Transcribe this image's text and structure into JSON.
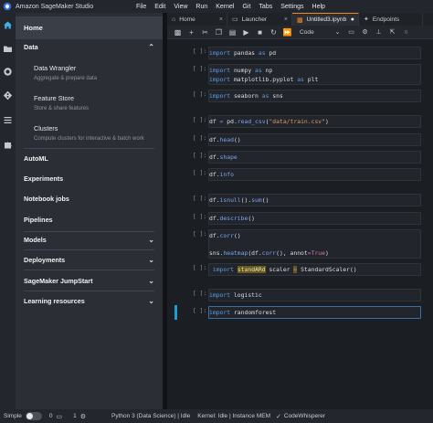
{
  "titlebar": {
    "app_title": "Amazon SageMaker Studio",
    "menu": [
      "File",
      "Edit",
      "View",
      "Run",
      "Kernel",
      "Git",
      "Tabs",
      "Settings",
      "Help"
    ]
  },
  "iconbar": {
    "icons": [
      "home-icon",
      "folder-icon",
      "running-icon",
      "git-icon",
      "list-icon",
      "extension-icon"
    ]
  },
  "sidebar": {
    "home": "Home",
    "data_header": "Data",
    "data_items": [
      {
        "title": "Data Wrangler",
        "desc": "Aggregate & prepare data"
      },
      {
        "title": "Feature Store",
        "desc": "Store & share features"
      },
      {
        "title": "Clusters",
        "desc": "Compute clusters for interactive & batch work"
      }
    ],
    "items": [
      "AutoML",
      "Experiments",
      "Notebook jobs",
      "Pipelines",
      "Models",
      "Deployments",
      "SageMaker JumpStart",
      "Learning resources"
    ]
  },
  "tabs": [
    {
      "label": "Home",
      "icon": "home-icon"
    },
    {
      "label": "Launcher",
      "icon": "launcher-icon"
    },
    {
      "label": "Untitled3.ipynb",
      "icon": "notebook-icon",
      "active": true
    },
    {
      "label": "Endpoints",
      "icon": "endpoints-icon"
    }
  ],
  "toolbar": {
    "cell_type": "Code",
    "icons": [
      "save-icon",
      "add-cell-icon",
      "cut-icon",
      "copy-icon",
      "paste-icon",
      "run-icon",
      "stop-icon",
      "restart-icon",
      "fast-forward-icon"
    ]
  },
  "cells": [
    {
      "prompt": "[ ]:",
      "lines": [
        "import pandas as pd"
      ]
    },
    {
      "prompt": "[ ]:",
      "lines": [
        "import numpy as np",
        "import matplotlib.pyplot as plt"
      ]
    },
    {
      "prompt": "[ ]:",
      "lines": [
        "import seaborn as sns"
      ]
    },
    {
      "prompt": "[ ]:",
      "lines": [
        "df = pd.read_csv(\"data/train.csv\")"
      ]
    },
    {
      "prompt": "[ ]:",
      "lines": [
        "df.head()"
      ]
    },
    {
      "prompt": "[ ]:",
      "lines": [
        "df.shape"
      ]
    },
    {
      "prompt": "[ ]:",
      "lines": [
        "df.info"
      ]
    },
    {
      "prompt": "[ ]:",
      "lines": [
        "df.isnull().sum()"
      ]
    },
    {
      "prompt": "[ ]:",
      "lines": [
        "df.describe()"
      ]
    },
    {
      "prompt": "[ ]:",
      "lines": [
        "df.corr()",
        "",
        "sns.heatmap(df.corr(), annot=True)"
      ]
    },
    {
      "prompt": "[ ]:",
      "lines": [
        " import standARd scaler = StandardScaler()"
      ]
    },
    {
      "prompt": "[ ]:",
      "lines": [
        "import logistic"
      ]
    },
    {
      "prompt": "[ ]:",
      "lines": [
        "import randomforest"
      ]
    }
  ],
  "status": {
    "mode": "Simple",
    "counter_a": "0",
    "counter_b": "1",
    "kernel": "Python 3 (Data Science) | Idle",
    "kernel_state": "Kernel: Idle | Instance MEM",
    "assistant": "CodeWhisperer"
  },
  "colors": {
    "accent": "#3fb0e6",
    "active_tab": "#f08a24",
    "keyword": "#5c9fe6",
    "string": "#d99f6a"
  }
}
